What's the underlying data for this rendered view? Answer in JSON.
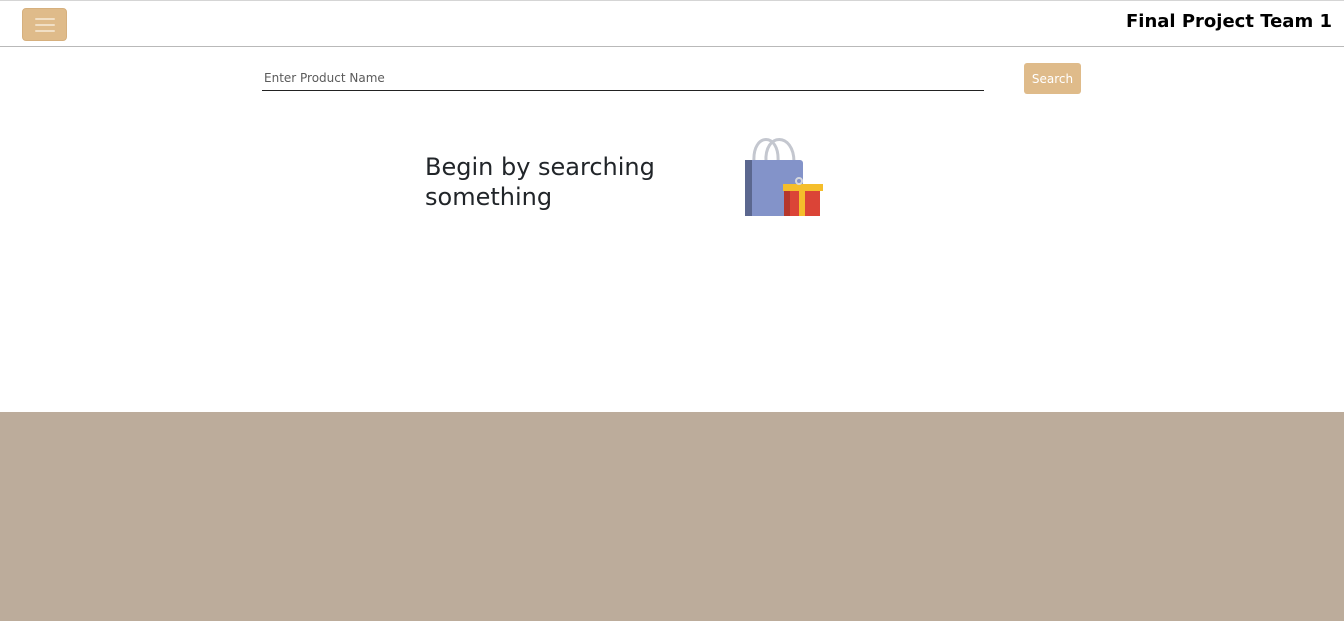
{
  "header": {
    "brand": "Final Project Team 1",
    "menu_icon": "hamburger-menu-icon"
  },
  "search": {
    "placeholder": "Enter Product Name",
    "value": "",
    "button_label": "Search"
  },
  "empty_state": {
    "message": "Begin by searching something",
    "illustration": "shopping-bag-with-gift-icon"
  },
  "colors": {
    "accent": "#dfbb8a",
    "footer": "#bcac9b",
    "text": "#212529"
  }
}
